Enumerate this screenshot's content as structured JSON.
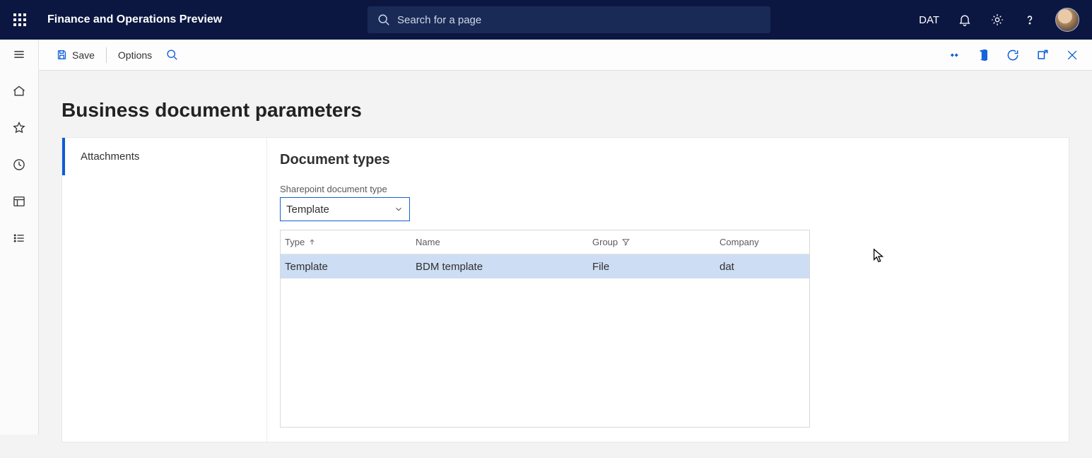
{
  "header": {
    "app_title": "Finance and Operations Preview",
    "search_placeholder": "Search for a page",
    "company": "DAT"
  },
  "actionbar": {
    "save_label": "Save",
    "options_label": "Options"
  },
  "page": {
    "title": "Business document parameters"
  },
  "tabs": {
    "items": [
      {
        "label": "Attachments"
      }
    ]
  },
  "section": {
    "heading": "Document types",
    "field_label": "Sharepoint document type",
    "dropdown_value": "Template"
  },
  "grid": {
    "columns": {
      "type": "Type",
      "name": "Name",
      "group": "Group",
      "company": "Company"
    },
    "rows": [
      {
        "type": "Template",
        "name": "BDM template",
        "group": "File",
        "company": "dat"
      }
    ]
  }
}
